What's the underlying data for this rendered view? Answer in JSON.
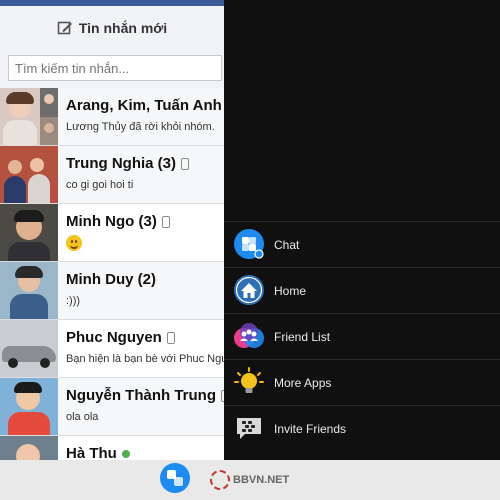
{
  "header": {
    "new_message_label": "Tin nhắn mới"
  },
  "search": {
    "placeholder": "Tìm kiếm tin nhắn..."
  },
  "conversations": [
    {
      "name": "Arang, Kim, Tuấn Anh v",
      "snippet": "Lương Thủy đã rời khỏi nhóm.",
      "device_icon": false
    },
    {
      "name": "Trung Nghia (3)",
      "snippet": "co gi goi hoi ti",
      "device_icon": true
    },
    {
      "name": "Minh Ngo (3)",
      "snippet": "",
      "emoji": "smile-emoji-icon",
      "device_icon": true
    },
    {
      "name": "Minh Duy (2)",
      "snippet": ":)))",
      "device_icon": false
    },
    {
      "name": "Phuc Nguyen",
      "snippet": "Bạn hiện là bạn bè với Phuc Nguy",
      "device_icon": true
    },
    {
      "name": "Nguyễn Thành Trung",
      "snippet": "ola ola",
      "device_icon": true
    },
    {
      "name": "Hà Thu",
      "snippet": ""
    }
  ],
  "menu": {
    "items": [
      {
        "label": "Chat",
        "icon": "chat-icon"
      },
      {
        "label": "Home",
        "icon": "home-icon"
      },
      {
        "label": "Friend List",
        "icon": "friend-list-icon"
      },
      {
        "label": "More Apps",
        "icon": "lightbulb-icon"
      },
      {
        "label": "Invite Friends",
        "icon": "invite-friends-icon"
      }
    ]
  },
  "watermark": {
    "text": "BBVN.NET"
  },
  "colors": {
    "brand_blue": "#3b5998",
    "chat_blue": "#1d8bf1",
    "panel_dark": "#101010"
  }
}
